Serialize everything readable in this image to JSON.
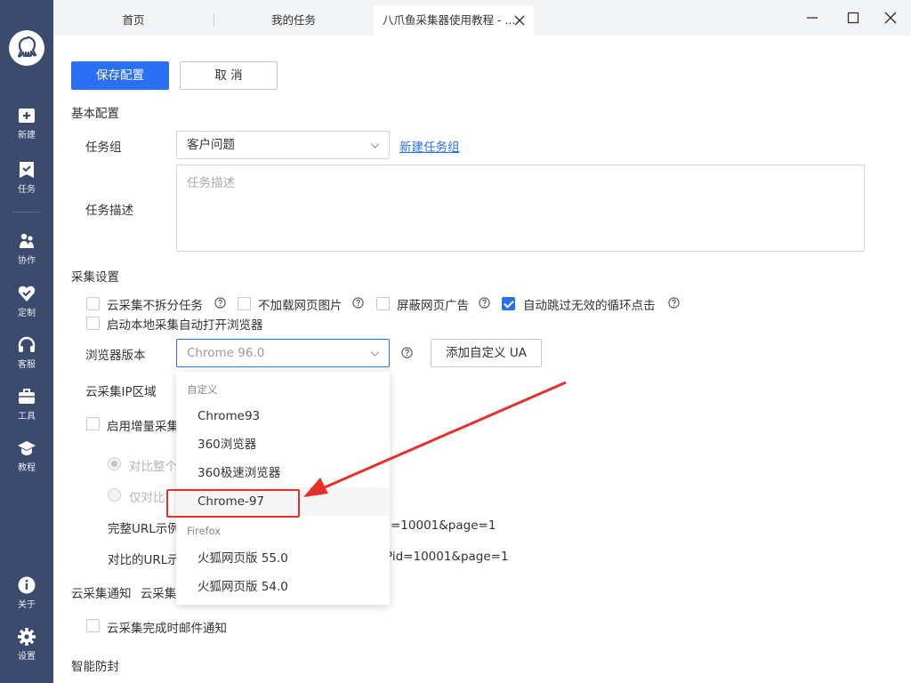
{
  "sidebar": {
    "items": [
      {
        "label": "新建",
        "icon": "plus-square-icon"
      },
      {
        "label": "任务",
        "icon": "task-check-icon"
      },
      {
        "label": "协作",
        "icon": "people-icon"
      },
      {
        "label": "定制",
        "icon": "heart-check-icon"
      },
      {
        "label": "客服",
        "icon": "headset-icon"
      },
      {
        "label": "工具",
        "icon": "toolbox-icon"
      },
      {
        "label": "教程",
        "icon": "graduation-cap-icon"
      },
      {
        "label": "关于",
        "icon": "info-icon"
      },
      {
        "label": "设置",
        "icon": "gear-icon"
      }
    ]
  },
  "tabs": [
    {
      "label": "首页"
    },
    {
      "label": "我的任务"
    },
    {
      "label": "八爪鱼采集器使用教程 - ..."
    }
  ],
  "toolbar": {
    "save_label": "保存配置",
    "cancel_label": "取 消"
  },
  "basic": {
    "section_title": "基本配置",
    "group_label": "任务组",
    "group_value": "客户问题",
    "new_group_link": "新建任务组",
    "desc_label": "任务描述",
    "desc_placeholder": "任务描述"
  },
  "collect": {
    "section_title": "采集设置",
    "options": [
      {
        "label": "云采集不拆分任务",
        "checked": false
      },
      {
        "label": "不加载网页图片",
        "checked": false
      },
      {
        "label": "屏蔽网页广告",
        "checked": false
      },
      {
        "label": "自动跳过无效的循环点击",
        "checked": true
      },
      {
        "label": "启动本地采集自动打开浏览器",
        "checked": false
      }
    ],
    "browser_label": "浏览器版本",
    "browser_value": "Chrome 96.0",
    "custom_ua_button": "添加自定义 UA",
    "ip_region_label": "云采集IP区域",
    "incremental_label": "启用增量采集",
    "radio_compare_all": "对比整个",
    "radio_compare_only": "仅对比",
    "full_url_label": "完整URL示例",
    "full_url_suffix": "=10001&page=1",
    "compare_url_label": "对比的URL示",
    "compare_url_suffix": "Pid=10001&page=1"
  },
  "notify": {
    "section_title": "云采集通知",
    "section_title_extra": "云采集",
    "email_option": "云采集完成时邮件通知"
  },
  "anti_block": {
    "section_title": "智能防封"
  },
  "dropdown": {
    "group_custom": "自定义",
    "items_custom": [
      "Chrome93",
      "360浏览器",
      "360极速浏览器",
      "Chrome-97"
    ],
    "group_firefox": "Firefox",
    "items_firefox": [
      "火狐网页版 55.0",
      "火狐网页版 54.0"
    ]
  },
  "colors": {
    "accent": "#2b6ff5",
    "sidebar": "#3a4b6d",
    "annotation": "#e8302a"
  }
}
